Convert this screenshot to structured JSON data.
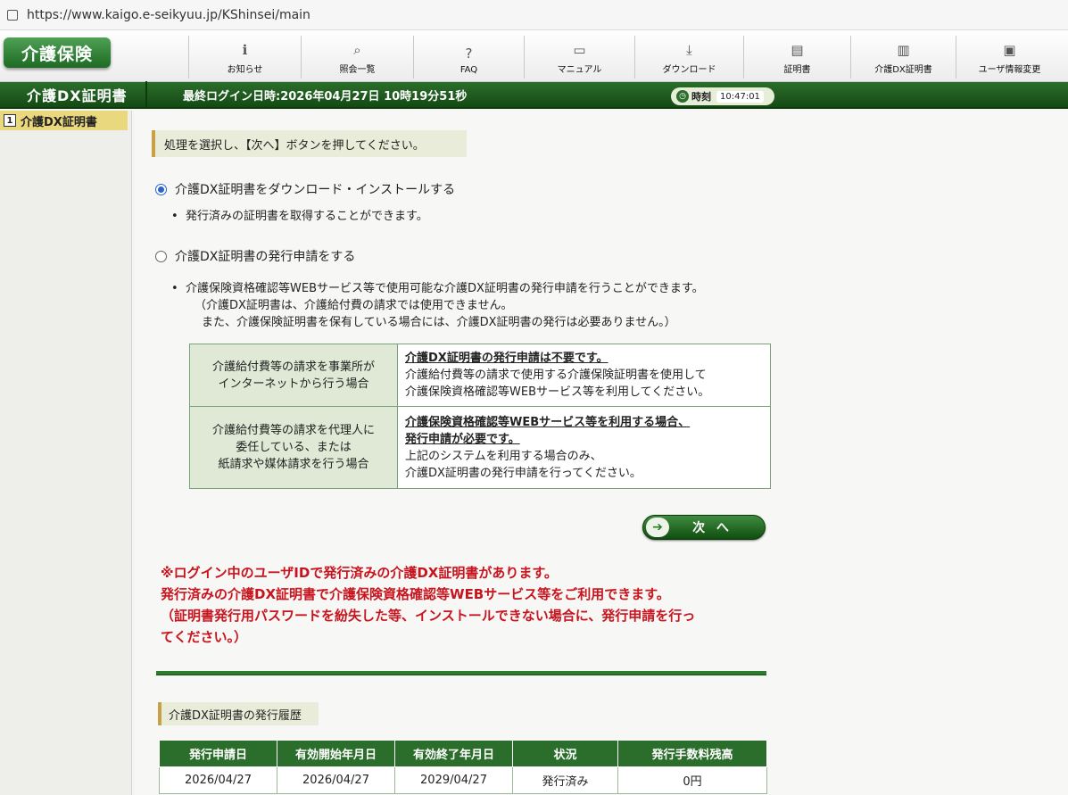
{
  "browser": {
    "url": "https://www.kaigo.e-seikyuu.jp/KShinsei/main"
  },
  "nav": {
    "logo": "介護保険",
    "items": [
      {
        "label": "お知らせ",
        "icon": "info-icon"
      },
      {
        "label": "照会一覧",
        "icon": "search-icon"
      },
      {
        "label": "FAQ",
        "icon": "faq-icon"
      },
      {
        "label": "マニュアル",
        "icon": "book-icon"
      },
      {
        "label": "ダウンロード",
        "icon": "download-icon"
      },
      {
        "label": "証明書",
        "icon": "certificate-icon"
      },
      {
        "label": "介護DX証明書",
        "icon": "dx-certificate-icon"
      },
      {
        "label": "ユーザ情報変更",
        "icon": "user-card-icon"
      }
    ]
  },
  "titlebar": {
    "title": "介護DX証明書",
    "last_login": "最終ログイン日時:2026年04月27日 10時19分51秒",
    "clock_label": "時刻",
    "clock_time": "10:47:01"
  },
  "sidebar": {
    "items": [
      {
        "num": "1",
        "label": "介護DX証明書"
      }
    ]
  },
  "main": {
    "instruction": "処理を選択し、【次へ】ボタンを押してください。",
    "option1": {
      "label": "介護DX証明書をダウンロード・インストールする",
      "note": "発行済みの証明書を取得することができます。"
    },
    "option2": {
      "label": "介護DX証明書の発行申請をする",
      "note1": "介護保険資格確認等WEBサービス等で使用可能な介護DX証明書の発行申請を行うことができます。",
      "note2": "（介護DX証明書は、介護給付費の請求では使用できません。",
      "note3": "また、介護保険証明書を保有している場合には、介護DX証明書の発行は必要ありません。）"
    },
    "table": {
      "row1": {
        "left1": "介護給付費等の請求を事業所が",
        "left2": "インターネットから行う場合",
        "right_head": "介護DX証明書の発行申請は不要です。",
        "right1": "介護給付費等の請求で使用する介護保険証明書を使用して",
        "right2": "介護保険資格確認等WEBサービス等を利用してください。"
      },
      "row2": {
        "left1": "介護給付費等の請求を代理人に",
        "left2": "委任している、または",
        "left3": "紙請求や媒体請求を行う場合",
        "right_head1": "介護保険資格確認等WEBサービス等を利用する場合、",
        "right_head2": "発行申請が必要です。",
        "right1": "上記のシステムを利用する場合のみ、",
        "right2": "介護DX証明書の発行申請を行ってください。"
      }
    },
    "next_button": "次 へ",
    "warning": {
      "line1": "※ログイン中のユーザIDで発行済みの介護DX証明書があります。",
      "line2": "発行済みの介護DX証明書で介護保険資格確認等WEBサービス等をご利用できます。",
      "line3": "（証明書発行用パスワードを紛失した等、インストールできない場合に、発行申請を行っ",
      "line4": "てください。）"
    },
    "history": {
      "title": "介護DX証明書の発行履歴",
      "headers": [
        "発行申請日",
        "有効開始年月日",
        "有効終了年月日",
        "状況",
        "発行手数料残高"
      ],
      "rows": [
        [
          "2026/04/27",
          "2026/04/27",
          "2029/04/27",
          "発行済み",
          "0円"
        ]
      ]
    }
  }
}
